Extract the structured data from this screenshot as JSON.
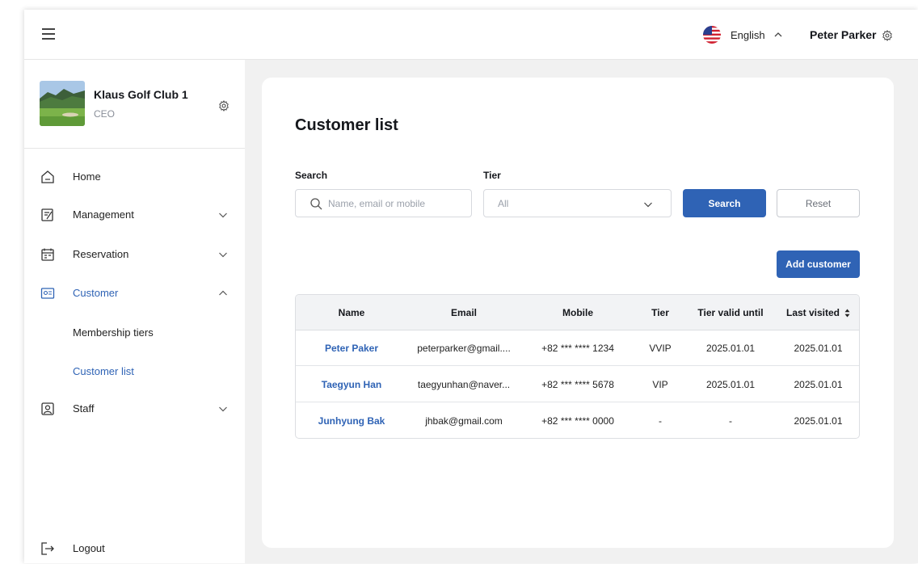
{
  "topbar": {
    "language": "English",
    "user_name": "Peter Parker"
  },
  "club": {
    "name": "Klaus Golf Club 1",
    "role": "CEO"
  },
  "nav": {
    "home": "Home",
    "management": "Management",
    "reservation": "Reservation",
    "customer": "Customer",
    "membership_tiers": "Membership tiers",
    "customer_list": "Customer list",
    "staff": "Staff",
    "logout": "Logout"
  },
  "page": {
    "title": "Customer list",
    "search_label": "Search",
    "search_placeholder": "Name, email or mobile",
    "tier_label": "Tier",
    "tier_value": "All",
    "search_button": "Search",
    "reset_button": "Reset",
    "add_button": "Add customer"
  },
  "table": {
    "headers": [
      "Name",
      "Email",
      "Mobile",
      "Tier",
      "Tier valid until",
      "Last visited"
    ],
    "rows": [
      [
        "Peter Paker",
        "peterparker@gmail....",
        "+82 *** **** 1234",
        "VVIP",
        "2025.01.01",
        "2025.01.01"
      ],
      [
        "Taegyun Han",
        "taegyunhan@naver...",
        "+82 *** **** 5678",
        "VIP",
        "2025.01.01",
        "2025.01.01"
      ],
      [
        "Junhyung Bak",
        "jhbak@gmail.com",
        "+82 *** **** 0000",
        "-",
        "-",
        "2025.01.01"
      ]
    ]
  },
  "colors": {
    "accent": "#2f63b5",
    "background": "#f1f1f1"
  }
}
